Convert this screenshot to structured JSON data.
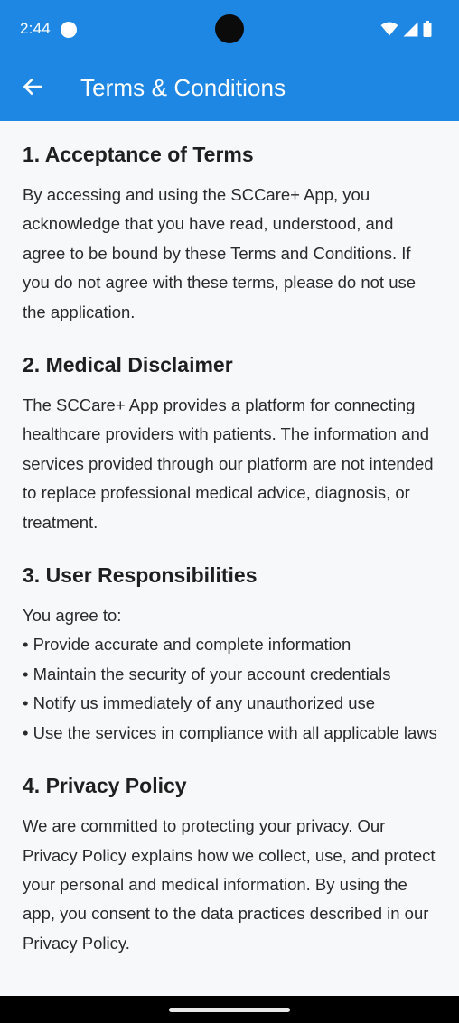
{
  "status_bar": {
    "time": "2:44",
    "icons": [
      "notification-dot-icon",
      "wifi-icon",
      "signal-icon",
      "battery-icon"
    ]
  },
  "app_bar": {
    "title": "Terms & Conditions",
    "back_icon": "arrow-left-icon",
    "color": "#1e86e3"
  },
  "sections": [
    {
      "heading": "1. Acceptance of Terms",
      "body": "By accessing and using the SCCare+ App, you acknowledge that you have read, understood, and agree to be bound by these Terms and Conditions. If you do not agree with these terms, please do not use the application."
    },
    {
      "heading": "2. Medical Disclaimer",
      "body": "The SCCare+ App provides a platform for connecting healthcare providers with patients. The information and services provided through our platform are not intended to replace professional medical advice, diagnosis, or treatment."
    },
    {
      "heading": "3. User Responsibilities",
      "intro": "You agree to:",
      "bullets": [
        "• Provide accurate and complete information",
        "• Maintain the security of your account credentials",
        "• Notify us immediately of any unauthorized use",
        "• Use the services in compliance with all applicable laws"
      ]
    },
    {
      "heading": "4. Privacy Policy",
      "body": "We are committed to protecting your privacy. Our Privacy Policy explains how we collect, use, and protect your personal and medical information. By using the app, you consent to the data practices described in our Privacy Policy."
    }
  ]
}
